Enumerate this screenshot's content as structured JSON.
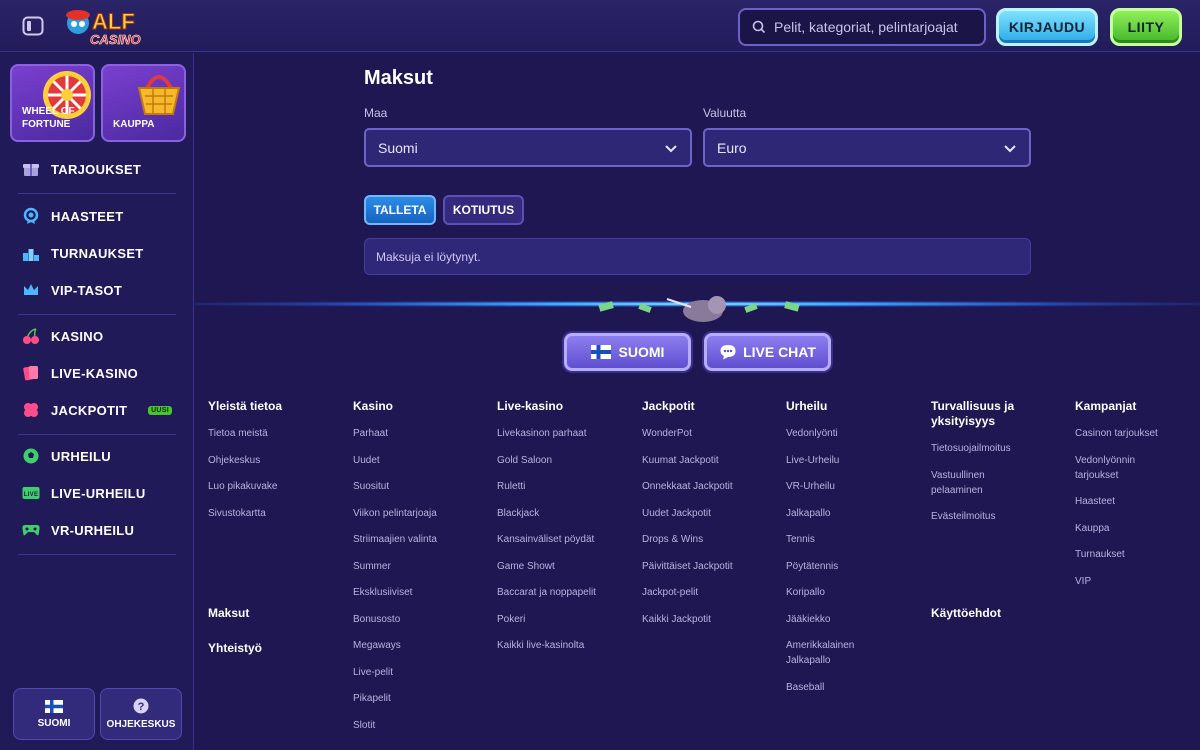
{
  "header": {
    "search_placeholder": "Pelit, kategoriat, pelintarjoajat",
    "login_label": "KIRJAUDU",
    "join_label": "LIITY",
    "logo_text": "ALF Casino"
  },
  "sidebar": {
    "tiles": [
      {
        "label": "WHEEL OF FORTUNE"
      },
      {
        "label": "KAUPPA"
      }
    ],
    "items": [
      {
        "label": "TARJOUKSET",
        "icon": "gift-icon"
      },
      {
        "label": "HAASTEET",
        "icon": "medal-icon"
      },
      {
        "label": "TURNAUKSET",
        "icon": "podium-icon"
      },
      {
        "label": "VIP-TASOT",
        "icon": "crown-icon"
      },
      {
        "label": "KASINO",
        "icon": "cherries-icon"
      },
      {
        "label": "LIVE-KASINO",
        "icon": "cards-icon"
      },
      {
        "label": "JACKPOTIT",
        "icon": "clover-icon",
        "badge": "UUSI"
      },
      {
        "label": "URHEILU",
        "icon": "soccer-ball-icon"
      },
      {
        "label": "LIVE-URHEILU",
        "icon": "live-icon"
      },
      {
        "label": "VR-URHEILU",
        "icon": "gamepad-icon"
      }
    ],
    "bottom": {
      "language": "SUOMI",
      "help": "OHJEKESKUS"
    }
  },
  "payments": {
    "title": "Maksut",
    "country_label": "Maa",
    "country_value": "Suomi",
    "currency_label": "Valuutta",
    "currency_value": "Euro",
    "tab_deposit": "TALLETA",
    "tab_withdraw": "KOTIUTUS",
    "empty_message": "Maksuja ei löytynyt."
  },
  "footer": {
    "language_button": "SUOMI",
    "livechat_button": "LIVE CHAT",
    "columns": [
      {
        "title": "Yleistä tietoa",
        "links": [
          "Tietoa meistä",
          "Ohjekeskus",
          "Luo pikakuvake",
          "Sivustokartta"
        ]
      },
      {
        "title": "Kasino",
        "links": [
          "Parhaat",
          "Uudet",
          "Suositut",
          "Viikon pelintarjoaja",
          "Striimaajien valinta",
          "Summer",
          "Eksklusiiviset",
          "Bonusosto",
          "Megaways",
          "Live-pelit",
          "Pikapelit",
          "Slotit"
        ]
      },
      {
        "title": "Live-kasino",
        "links": [
          "Livekasinon parhaat",
          "Gold Saloon",
          "Ruletti",
          "Blackjack",
          "Kansainväliset pöydät",
          "Game Showt",
          "Baccarat ja noppapelit",
          "Pokeri",
          "Kaikki live-kasinolta"
        ]
      },
      {
        "title": "Jackpotit",
        "links": [
          "WonderPot",
          "Kuumat Jackpotit",
          "Onnekkaat Jackpotit",
          "Uudet Jackpotit",
          "Drops & Wins",
          "Päivittäiset Jackpotit",
          "Jackpot-pelit",
          "Kaikki Jackpotit"
        ]
      },
      {
        "title": "Urheilu",
        "links": [
          "Vedonlyönti",
          "Live-Urheilu",
          "VR-Urheilu",
          "Jalkapallo",
          "Tennis",
          "Pöytätennis",
          "Koripallo",
          "Jääkiekko",
          "Amerikkalainen Jalkapallo",
          "Baseball"
        ]
      },
      {
        "title": "Turvallisuus ja yksityisyys",
        "links": [
          "Tietosuojailmoitus",
          "Vastuullinen pelaaminen",
          "Evästeilmoitus"
        ]
      },
      {
        "title": "Kampanjat",
        "links": [
          "Casinon tarjoukset",
          "Vedonlyönnin tarjoukset",
          "Haasteet",
          "Kauppa",
          "Turnaukset",
          "VIP"
        ]
      }
    ],
    "maksut": "Maksut",
    "yhteistyo": "Yhteistyö",
    "kayttoehdot": "Käyttöehdot"
  }
}
